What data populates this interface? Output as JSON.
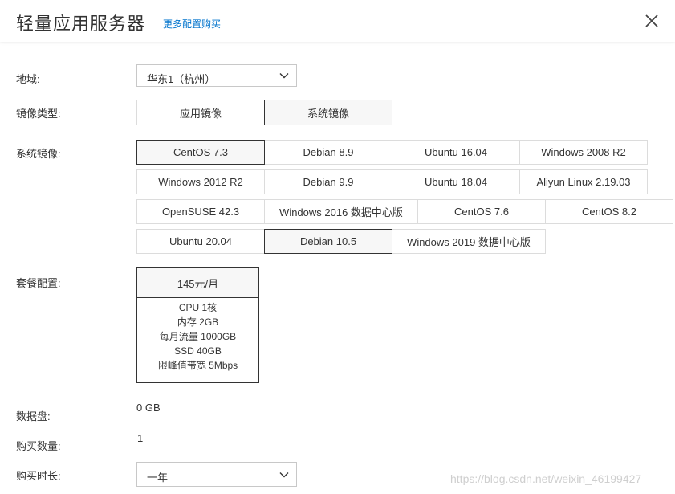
{
  "header": {
    "title": "轻量应用服务器",
    "more_config_link": "更多配置购买",
    "close_icon": "close-icon"
  },
  "region": {
    "label": "地域:",
    "value": "华东1（杭州）"
  },
  "image_type": {
    "label": "镜像类型:",
    "options": [
      "应用镜像",
      "系统镜像"
    ],
    "selected": "系统镜像"
  },
  "system_image": {
    "label": "系统镜像:",
    "options": [
      "CentOS 7.3",
      "Debian 8.9",
      "Ubuntu 16.04",
      "Windows 2008 R2",
      "Windows 2012 R2",
      "Debian 9.9",
      "Ubuntu 18.04",
      "Aliyun Linux 2.19.03",
      "OpenSUSE 42.3",
      "Windows 2016 数据中心版",
      "CentOS 7.6",
      "CentOS 8.2",
      "Ubuntu 20.04",
      "Debian 10.5",
      "Windows 2019 数据中心版"
    ],
    "selected": [
      "CentOS 7.3",
      "Debian 10.5"
    ]
  },
  "plan": {
    "label": "套餐配置:",
    "price": "145元/月",
    "specs": [
      "CPU 1核",
      "内存 2GB",
      "每月流量 1000GB",
      "SSD 40GB",
      "限峰值带宽 5Mbps"
    ]
  },
  "data_disk": {
    "label": "数据盘:",
    "value": "0 GB"
  },
  "quantity": {
    "label": "购买数量:",
    "value": "1"
  },
  "duration": {
    "label": "购买时长:",
    "value": "一年"
  },
  "watermark": "https://blog.csdn.net/weixin_46199427",
  "colors": {
    "link": "#0073cc",
    "selected_border": "#333333",
    "tile_border": "#dcdcdc"
  }
}
